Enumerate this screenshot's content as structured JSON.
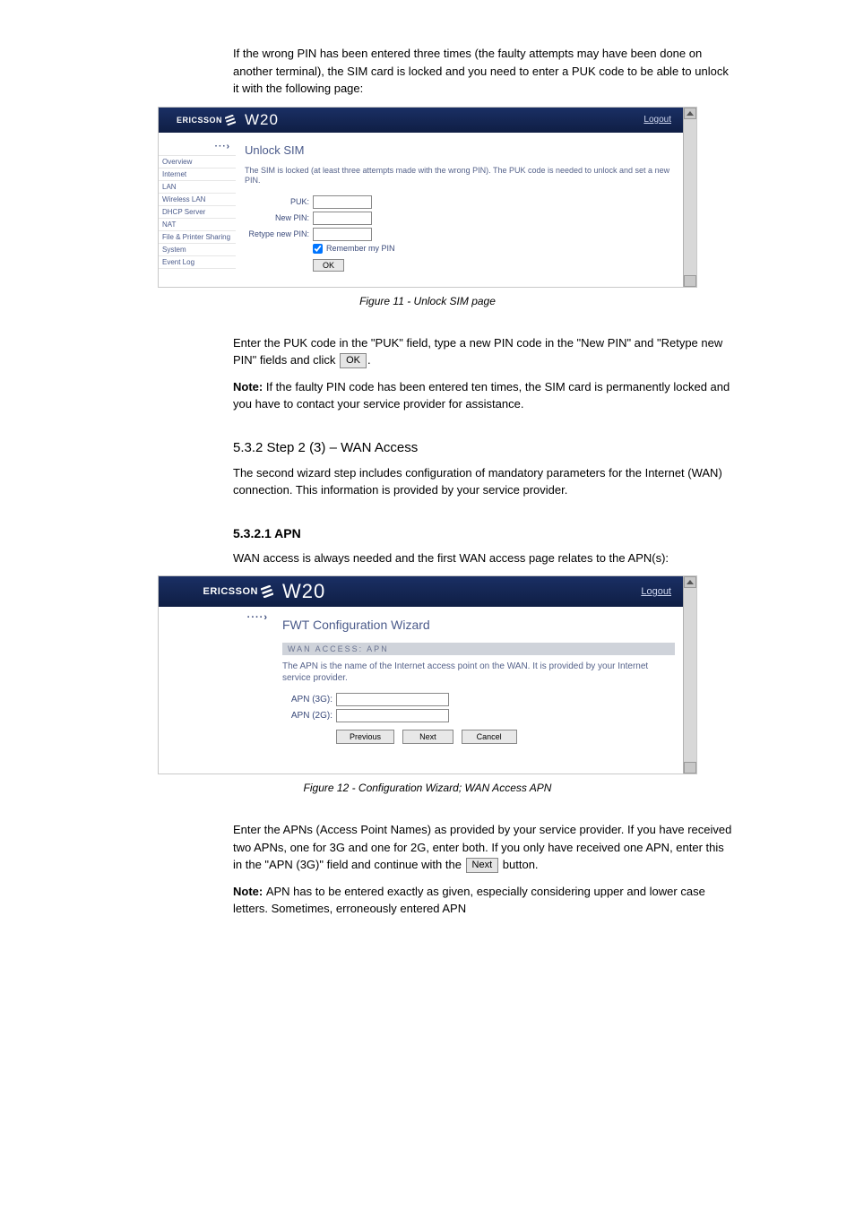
{
  "doc": {
    "intro": "If the wrong PIN has been entered three times (the faulty attempts may have been done on another terminal), the SIM card is locked and you need to enter a PUK code to be able to unlock it with the following page:",
    "fig1_caption": "Figure 11 - Unlock SIM page",
    "puk_para1_prefix": "Enter the PUK code in the \"PUK\" field, type a new PIN code in the \"New PIN\" and \"Retype new PIN\" fields and click ",
    "ok_btn": "OK",
    "period": ".",
    "puk_note": "Note: If the faulty PIN code has been entered ten times, the SIM card is permanently locked and you have to contact your service provider for assistance.",
    "step2_title": "5.3.2 Step 2 (3) – WAN Access",
    "step2_intro": "The second wizard step includes configuration of mandatory parameters for the Internet (WAN) connection. This information is provided by your service provider.",
    "sub321_title": "5.3.2.1 APN",
    "sub321_intro": "WAN access is always needed and the first WAN access page relates to the APN(s):",
    "fig2_caption": "Figure 12 - Configuration Wizard; WAN Access APN",
    "apn_para_prefix": "Enter the APNs (Access Point Names) as provided by your service provider. If you have received two APNs, one for 3G and one for 2G, enter both. If you only have received one APN, enter this in the \"APN (3G)\" field and continue with the ",
    "next_btn": "Next",
    "apn_para_suffix": " button.",
    "apn_note_prefix": "Note: ",
    "apn_note_body": "APN has to be entered exactly as given, especially considering upper and lower case letters. Sometimes, erroneously entered APN"
  },
  "shot1": {
    "brand": "ERICSSON",
    "product": "W20",
    "logout": "Logout",
    "nav": {
      "overview": "Overview",
      "internet": "Internet",
      "lan": "LAN",
      "wlan": "Wireless LAN",
      "dhcp": "DHCP Server",
      "nat": "NAT",
      "fileprint": "File & Printer Sharing",
      "system": "System",
      "eventlog": "Event Log"
    },
    "heading": "Unlock SIM",
    "lead": "The SIM is locked (at least three attempts made with the wrong PIN). The PUK code is needed to unlock and set a new PIN.",
    "labels": {
      "puk": "PUK:",
      "newpin": "New PIN:",
      "retype": "Retype new PIN:",
      "remember": "Remember my PIN"
    },
    "ok": "OK"
  },
  "shot2": {
    "brand": "ERICSSON",
    "product": "W20",
    "logout": "Logout",
    "heading": "FWT Configuration Wizard",
    "section": "WAN ACCESS: APN",
    "lead": "The APN is the name of the Internet access point on the WAN. It is provided by your Internet service provider.",
    "labels": {
      "apn3g": "APN (3G):",
      "apn2g": "APN (2G):"
    },
    "buttons": {
      "previous": "Previous",
      "next": "Next",
      "cancel": "Cancel"
    }
  }
}
